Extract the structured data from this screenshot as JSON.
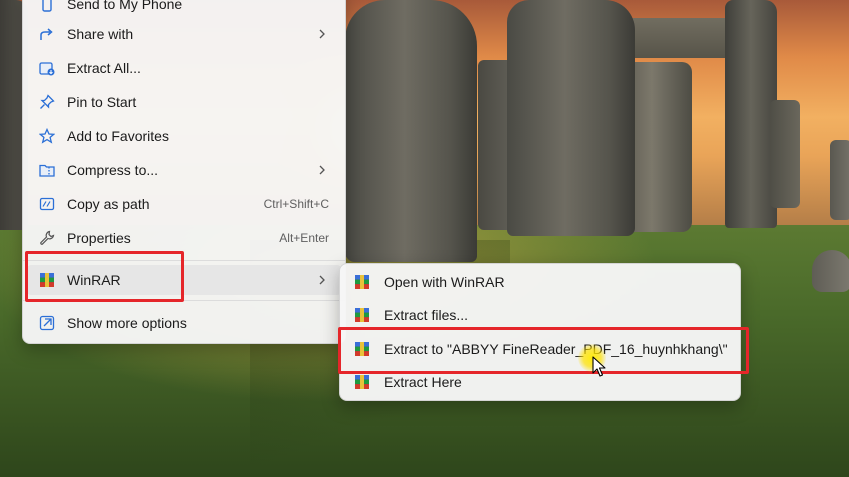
{
  "main_menu": {
    "items": [
      {
        "label": "Send to My Phone",
        "icon": "phone-icon"
      },
      {
        "label": "Share with",
        "icon": "share-icon",
        "has_submenu": true
      },
      {
        "label": "Extract All...",
        "icon": "extract-all-icon"
      },
      {
        "label": "Pin to Start",
        "icon": "pin-icon"
      },
      {
        "label": "Add to Favorites",
        "icon": "star-icon"
      },
      {
        "label": "Compress to...",
        "icon": "folder-zip-icon",
        "has_submenu": true
      },
      {
        "label": "Copy as path",
        "icon": "copy-path-icon",
        "shortcut": "Ctrl+Shift+C"
      },
      {
        "label": "Properties",
        "icon": "wrench-icon",
        "shortcut": "Alt+Enter"
      },
      {
        "label": "WinRAR",
        "icon": "winrar-icon",
        "has_submenu": true,
        "highlighted": true
      },
      {
        "label": "Show more options",
        "icon": "show-more-icon"
      }
    ]
  },
  "winrar_submenu": {
    "items": [
      {
        "label": "Open with WinRAR",
        "icon": "winrar-icon"
      },
      {
        "label": "Extract files...",
        "icon": "winrar-icon"
      },
      {
        "label": "Extract to \"ABBYY FineReader_PDF_16_huynhkhang\\\"",
        "icon": "winrar-icon",
        "highlighted": true
      },
      {
        "label": "Extract Here",
        "icon": "winrar-icon"
      }
    ]
  },
  "colors": {
    "highlight_box": "#e5262a",
    "accent_blue": "#2b6fd6",
    "cursor_glow": "#ffe600"
  }
}
